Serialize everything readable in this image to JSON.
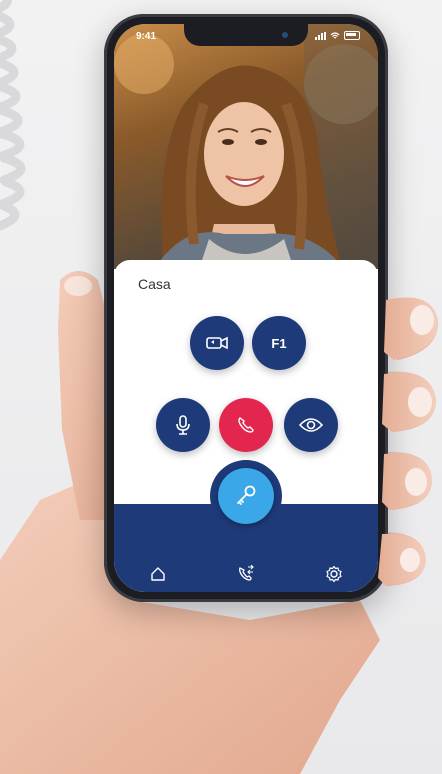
{
  "status_bar": {
    "time": "9:41"
  },
  "panel": {
    "title": "Casa"
  },
  "controls": {
    "f1_label": "F1"
  },
  "colors": {
    "primary": "#1e3a78",
    "hangup": "#e3264e",
    "door": "#3aa7e8"
  },
  "icons": {
    "switch_camera": "switch-camera-icon",
    "microphone": "microphone-icon",
    "hangup": "phone-hangup-icon",
    "eye": "eye-icon",
    "door_key": "key-icon",
    "home": "home-icon",
    "calls": "phone-calls-icon",
    "settings": "gear-icon"
  }
}
